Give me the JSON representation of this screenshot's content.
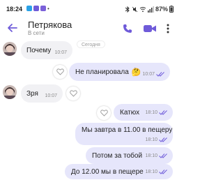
{
  "status_bar": {
    "time": "18:24",
    "battery": "87%",
    "icons": [
      "bluetooth-icon",
      "mute-icon",
      "wifi-icon",
      "signal-icon",
      "battery-icon"
    ]
  },
  "header": {
    "contact_name": "Петрякова",
    "contact_status": "В сети",
    "accent_color": "#6f5bd9"
  },
  "chat": {
    "date_chip": "Сегодня",
    "messages": [
      {
        "direction": "in",
        "text": "Почему",
        "time": "10:07"
      },
      {
        "direction": "out",
        "text": "Не планировала",
        "emoji": "🤔",
        "time": "10:07",
        "status": "read"
      },
      {
        "direction": "in",
        "text": "Зря",
        "time": "10:07"
      },
      {
        "direction": "out",
        "text": "Катюх",
        "time": "18:10",
        "status": "read"
      },
      {
        "direction": "out",
        "text": "Мы завтра в 11.00 в пещеру",
        "time": "18:10",
        "status": "read"
      },
      {
        "direction": "out",
        "text": "Потом за тобой",
        "time": "18:10",
        "status": "read"
      },
      {
        "direction": "out",
        "text": "До 12.00 мы в пещере",
        "time": "18:10",
        "status": "read"
      }
    ]
  },
  "colors": {
    "incoming_bubble": "#f1f1f4",
    "outgoing_bubble": "#e6e6fb",
    "read_ticks": "#6f5bd9"
  }
}
